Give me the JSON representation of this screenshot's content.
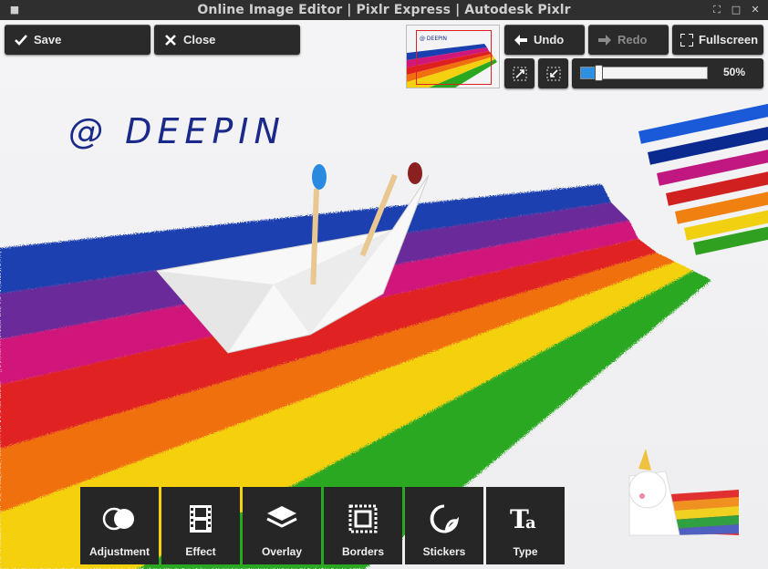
{
  "window": {
    "title": "Online Image Editor | Pixlr Express | Autodesk Pixlr"
  },
  "toolbar": {
    "save_label": "Save",
    "close_label": "Close",
    "undo_label": "Undo",
    "redo_label": "Redo",
    "fullscreen_label": "Fullscreen"
  },
  "zoom": {
    "value_label": "50%",
    "level": 0.14
  },
  "canvas": {
    "watermark_text": "@ DEEPIN",
    "thumbnail_text": "@ DEEPIN"
  },
  "tools": [
    {
      "label": "Adjustment",
      "icon": "adjustment-circles-icon"
    },
    {
      "label": "Effect",
      "icon": "film-strip-icon"
    },
    {
      "label": "Overlay",
      "icon": "layers-icon"
    },
    {
      "label": "Borders",
      "icon": "frame-icon"
    },
    {
      "label": "Stickers",
      "icon": "sticker-icon"
    },
    {
      "label": "Type",
      "icon": "text-type-icon"
    }
  ],
  "colors": {
    "chrome": "#2a2a2a",
    "slider_fill": "#2f8fe0",
    "watermark": "#1a2a8a"
  }
}
